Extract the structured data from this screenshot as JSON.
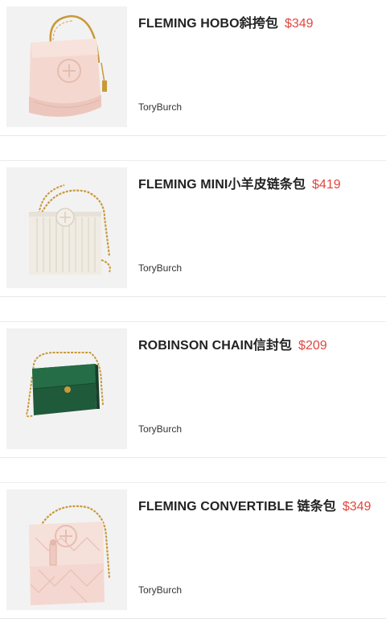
{
  "products": [
    {
      "name": "FLEMING HOBO斜挎包",
      "price": "$349",
      "brand": "ToryBurch",
      "image_icon": "pink-hobo-bag-icon"
    },
    {
      "name": "FLEMING MINI小羊皮链条包",
      "price": "$419",
      "brand": "ToryBurch",
      "image_icon": "white-quilted-chain-bag-icon"
    },
    {
      "name": "ROBINSON CHAIN信封包",
      "price": "$209",
      "brand": "ToryBurch",
      "image_icon": "green-envelope-chain-bag-icon"
    },
    {
      "name": "FLEMING CONVERTIBLE 链条包",
      "price": "$349",
      "brand": "ToryBurch",
      "image_icon": "pink-quilted-convertible-bag-icon"
    }
  ],
  "colors": {
    "price": "#e0473f",
    "text": "#222222",
    "divider": "#e8e8e8"
  }
}
